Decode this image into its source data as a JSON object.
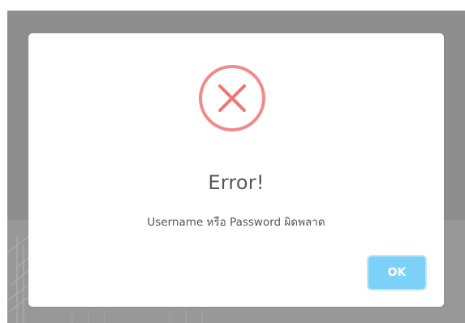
{
  "dialog": {
    "title": "Error!",
    "message": "Username หรือ Password ผิดพลาด",
    "ok_label": "OK",
    "icon": "error-x-circle-icon"
  },
  "colors": {
    "icon_stroke": "#f27474",
    "ok_button": "#7cd1f9",
    "ok_button_border": "#c4e6f5",
    "overlay": "#8e8e8e"
  }
}
